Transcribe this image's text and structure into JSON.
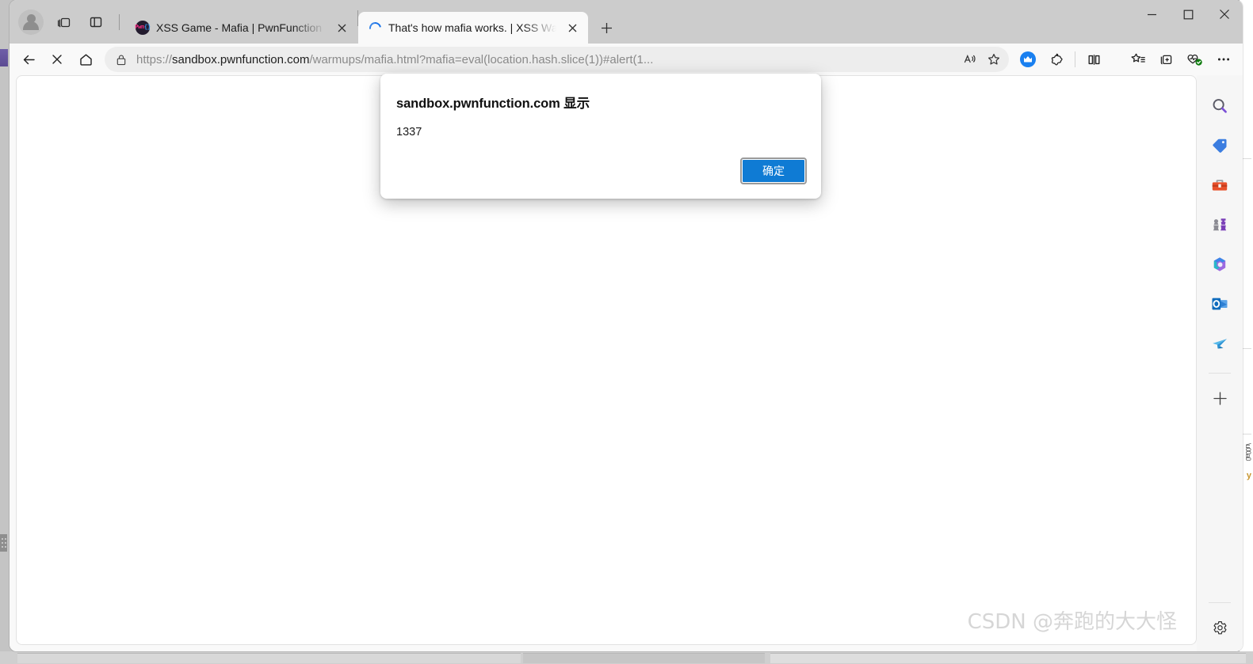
{
  "window": {
    "controls": {
      "minimize": "—",
      "maximize": "□",
      "close": "✕"
    }
  },
  "tabstrip": {
    "profile_label": "Profile",
    "workspaces_label": "Workspaces",
    "tab_actions_label": "Tab actions menu",
    "new_tab_label": "+",
    "tabs": [
      {
        "title": "XSS Game - Mafia | PwnFunction",
        "favicon": "pwnfunction-favicon",
        "favicon_text_a": "Pwn",
        "favicon_text_b": "{}",
        "active": false,
        "close_label": "✕"
      },
      {
        "title": "That's how mafia works. | XSS Wa",
        "favicon": "loading-spinner",
        "active": true,
        "close_label": "✕"
      }
    ]
  },
  "toolbar": {
    "back_label": "Back",
    "stop_label": "Stop loading",
    "home_label": "Home",
    "url_scheme": "https://",
    "url_host": "sandbox.pwnfunction.com",
    "url_path": "/warmups/mafia.html?mafia=eval(location.hash.slice(1))#alert(1...",
    "read_aloud_label": "Read aloud",
    "favorite_label": "Add this page to favorites",
    "extension_crown_label": "Extension",
    "extension_puzzle_label": "Extensions",
    "split_screen_label": "Split screen",
    "favorites_label": "Favorites",
    "collections_label": "Collections",
    "browser_essentials_label": "Browser essentials",
    "settings_more_label": "Settings and more"
  },
  "edgebar": {
    "items": [
      {
        "name": "search-icon",
        "label": "Search"
      },
      {
        "name": "shopping-tag-icon",
        "label": "Shopping"
      },
      {
        "name": "toolbox-icon",
        "label": "Tools"
      },
      {
        "name": "games-icon",
        "label": "Games"
      },
      {
        "name": "copilot-icon",
        "label": "Copilot"
      },
      {
        "name": "outlook-icon",
        "label": "Outlook"
      },
      {
        "name": "paper-plane-icon",
        "label": "Send"
      }
    ],
    "add_label": "+",
    "customize_label": "Customize"
  },
  "dialog": {
    "title": "sandbox.pwnfunction.com 显示",
    "message": "1337",
    "ok_label": "确定"
  },
  "page": {
    "watermark": "CSDN @奔跑的大大怪"
  },
  "colors": {
    "accent_blue": "#0f7bd4",
    "tab_active": "#f9f9f9",
    "titlebar": "#cccccc",
    "spinner": "#1a73e8"
  }
}
